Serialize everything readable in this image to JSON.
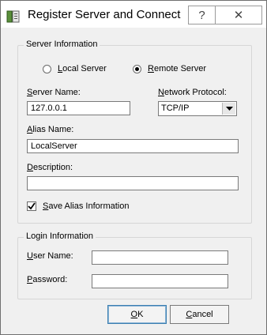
{
  "window": {
    "title": "Register Server and Connect",
    "help_glyph": "?",
    "close_glyph": "✕"
  },
  "server_info": {
    "group_label": "Server Information",
    "local_label": "Local Server",
    "remote_label": "Remote Server",
    "selected": "remote",
    "server_name_label": "Server Name:",
    "server_name_value": "127.0.0.1",
    "protocol_label": "Network Protocol:",
    "protocol_value": "TCP/IP",
    "alias_label": "Alias Name:",
    "alias_value": "LocalServer",
    "description_label": "Description:",
    "description_value": "",
    "save_alias_label": "Save Alias Information",
    "save_alias_checked": true
  },
  "login_info": {
    "group_label": "Login Information",
    "user_label": "User Name:",
    "user_value": "",
    "password_label": "Password:",
    "password_value": ""
  },
  "buttons": {
    "ok": "OK",
    "cancel": "Cancel"
  },
  "icons": [
    "database-server-icon",
    "help-icon",
    "close-icon",
    "dropdown-arrow-icon",
    "checkmark-icon"
  ]
}
